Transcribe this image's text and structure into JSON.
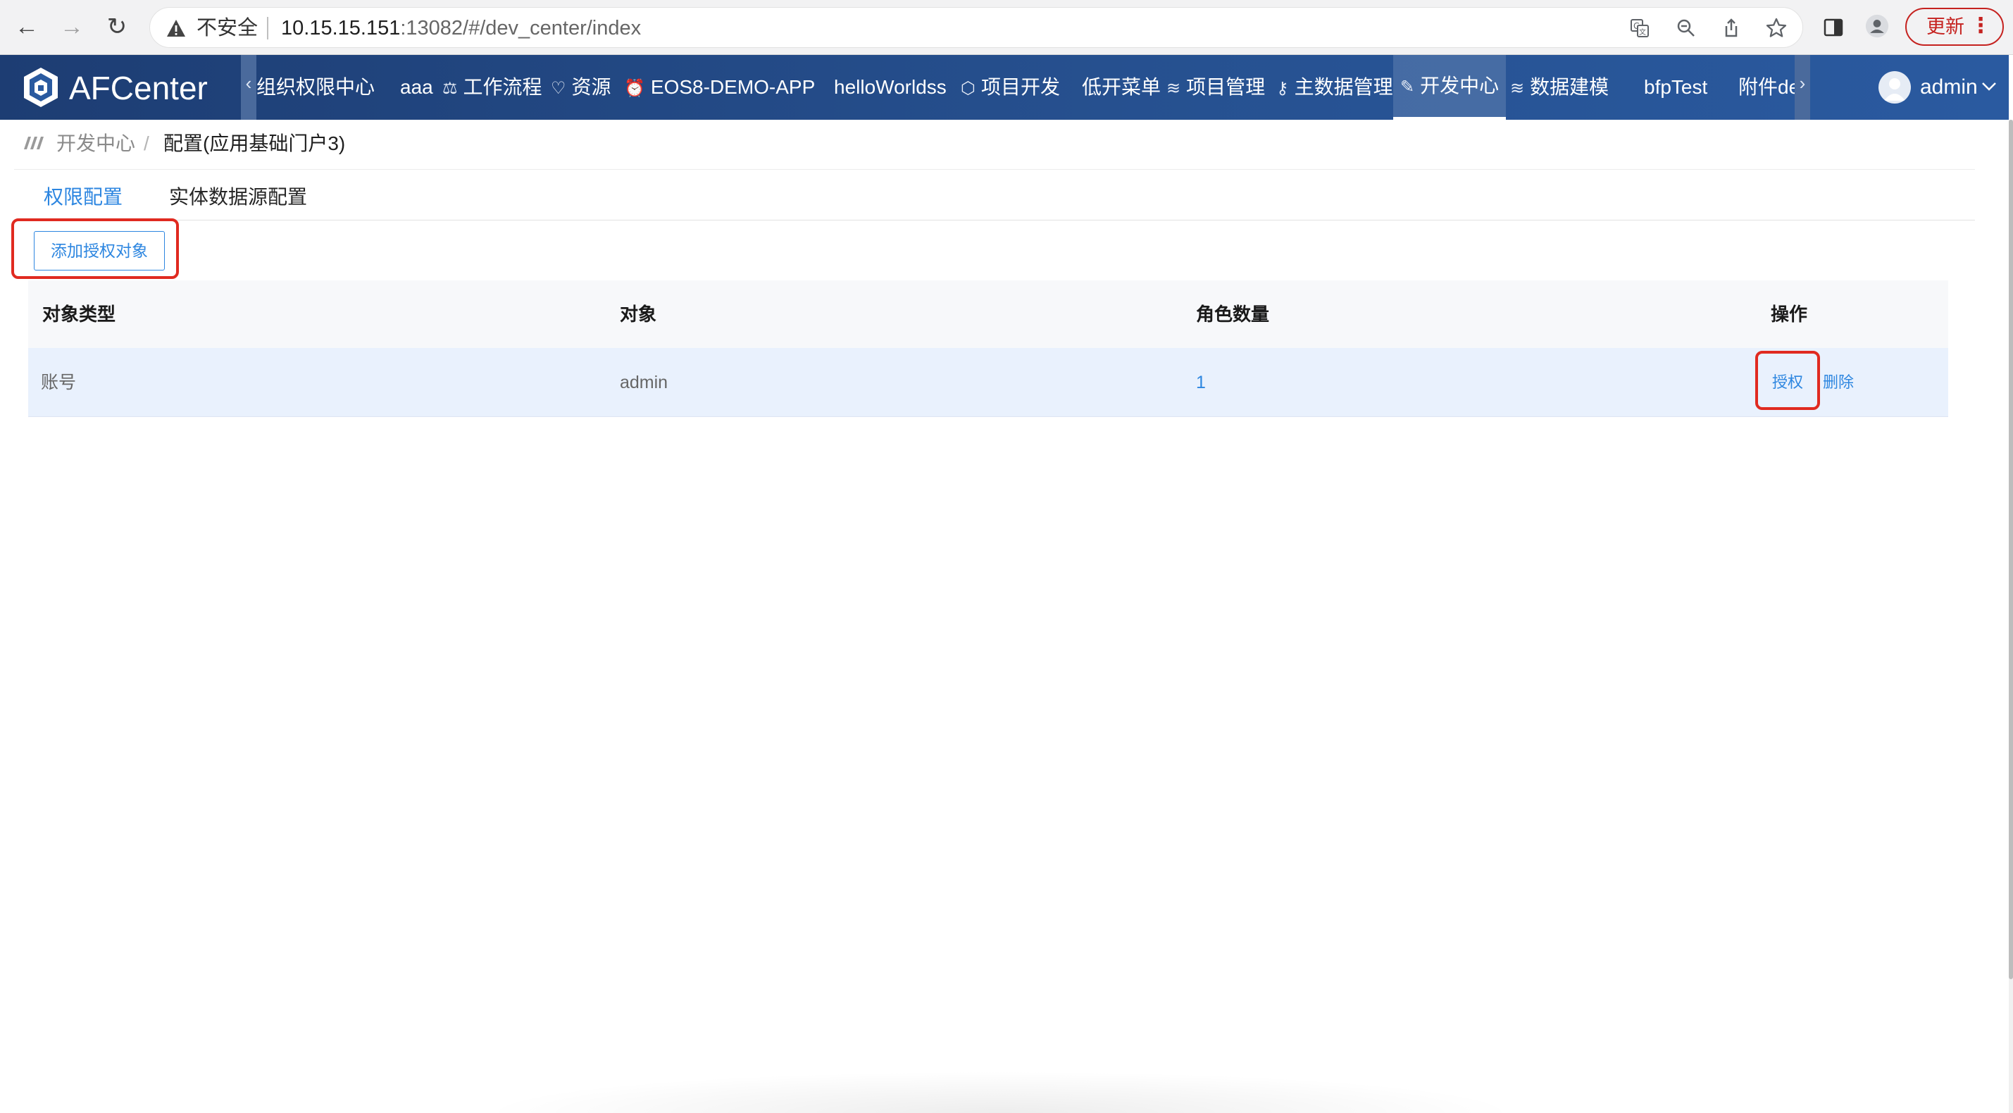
{
  "browser": {
    "security_text": "不安全",
    "url_host": "10.15.15.151",
    "url_rest": ":13082/#/dev_center/index",
    "update_label": "更新",
    "update_menu_glyph": "⋮",
    "back_glyph": "←",
    "forward_glyph": "→",
    "reload_glyph": "↻"
  },
  "app": {
    "brand": "AFCenter",
    "nav_prev_glyph": "‹",
    "nav_next_glyph": "›",
    "nav": [
      {
        "label": "组织权限中心",
        "icon": ""
      },
      {
        "label": "aaa",
        "icon": ""
      },
      {
        "label": "工作流程",
        "icon": "⚖"
      },
      {
        "label": "资源",
        "icon": "♡"
      },
      {
        "label": "EOS8-DEMO-APP",
        "icon": "⏰"
      },
      {
        "label": "helloWorldss",
        "icon": ""
      },
      {
        "label": "项目开发",
        "icon": "⬡"
      },
      {
        "label": "低开菜单",
        "icon": ""
      },
      {
        "label": "项目管理",
        "icon": "≋"
      },
      {
        "label": "主数据管理",
        "icon": "⚷"
      },
      {
        "label": "开发中心",
        "icon": "✎"
      },
      {
        "label": "数据建模",
        "icon": "≋"
      },
      {
        "label": "bfpTest",
        "icon": ""
      },
      {
        "label": "附件de",
        "icon": ""
      }
    ],
    "user": "admin"
  },
  "breadcrumb": {
    "parent": "开发中心",
    "separator": "/",
    "current": "配置(应用基础门户3)"
  },
  "tabs": [
    {
      "label": "权限配置",
      "active": true
    },
    {
      "label": "实体数据源配置",
      "active": false
    }
  ],
  "toolbar": {
    "add_label": "添加授权对象"
  },
  "table": {
    "headers": [
      "对象类型",
      "对象",
      "角色数量",
      "操作"
    ],
    "rows": [
      {
        "type": "账号",
        "object": "admin",
        "role_count": "1",
        "action_grant": "授权",
        "action_delete": "删除"
      }
    ]
  },
  "colors": {
    "accent": "#2d86e0",
    "header_bg": "#26508f",
    "highlight_box": "#e02a20",
    "row_selected": "#e9f1fd"
  }
}
